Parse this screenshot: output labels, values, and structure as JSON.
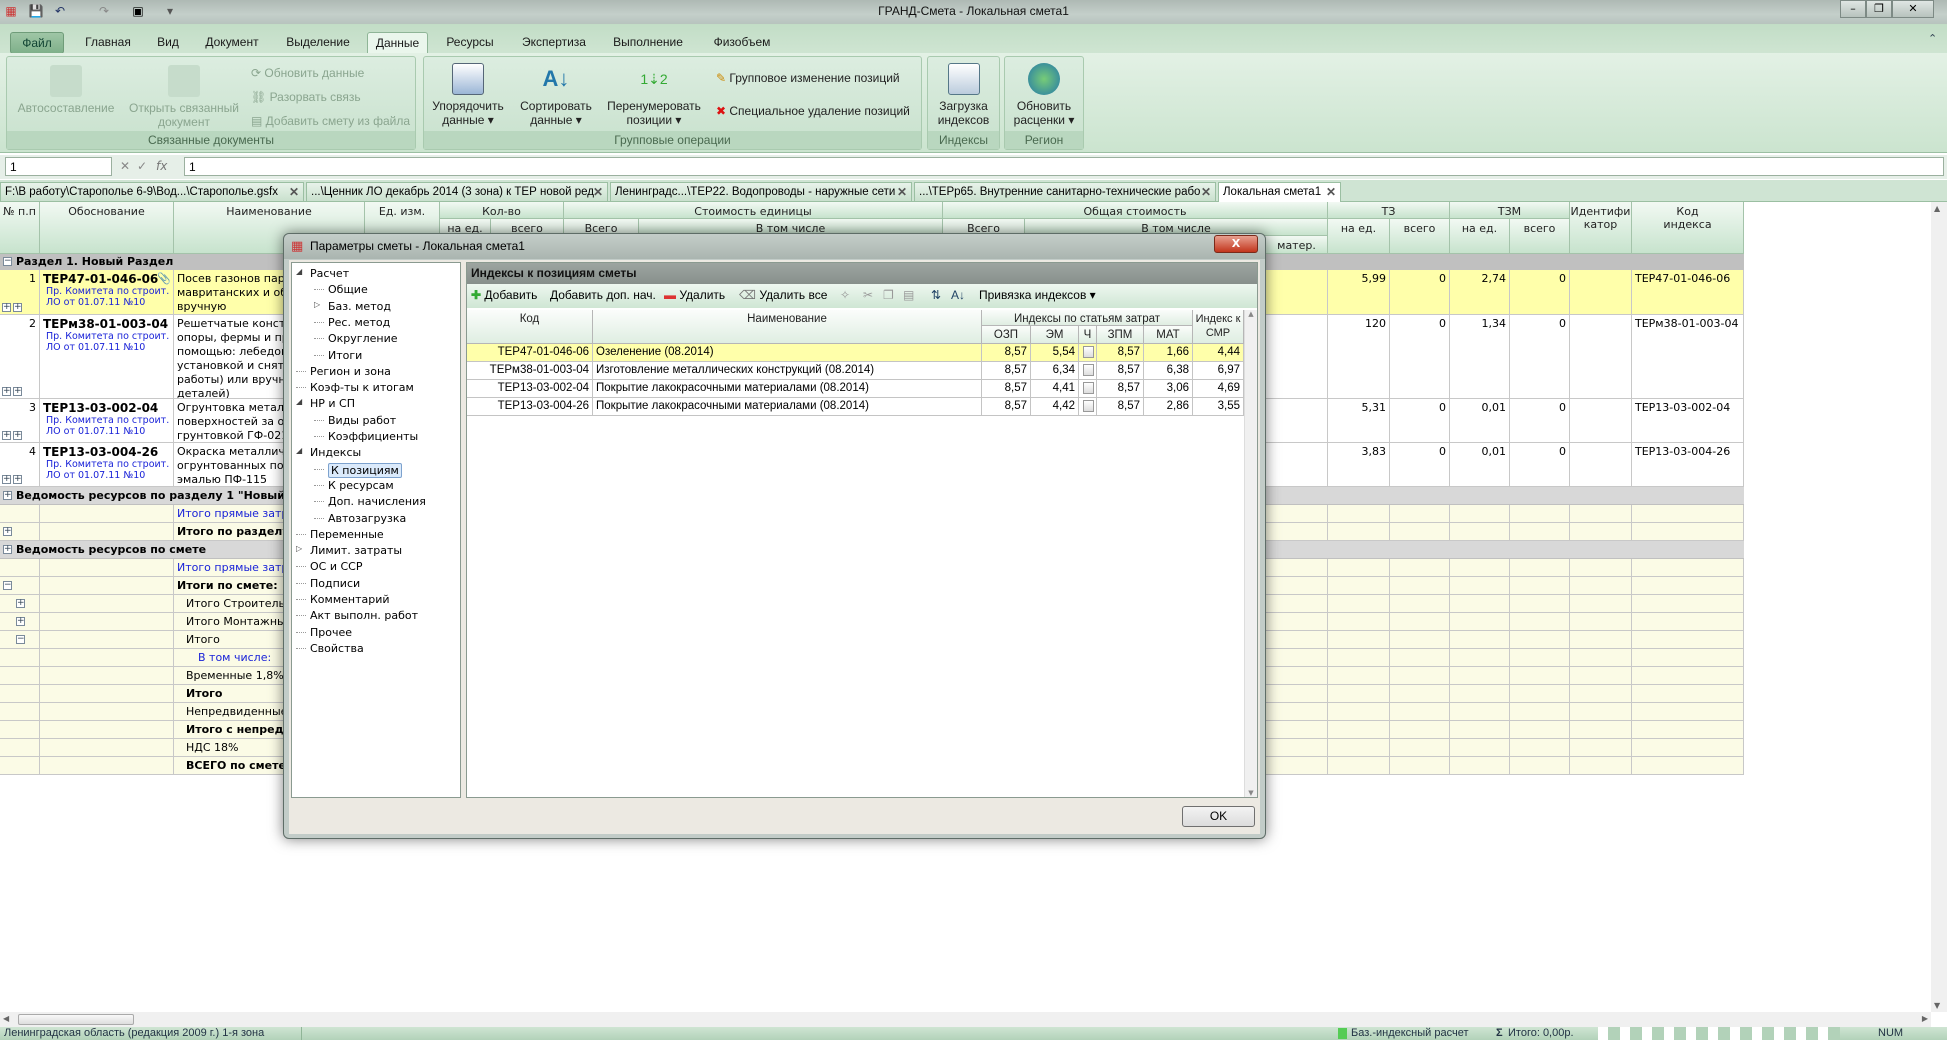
{
  "window": {
    "title": "ГРАНД-Смета - Локальная смета1"
  },
  "ribbon": {
    "tabs": [
      "Файл",
      "Главная",
      "Вид",
      "Документ",
      "Выделение",
      "Данные",
      "Ресурсы",
      "Экспертиза",
      "Выполнение",
      "Физобъем"
    ],
    "active_tab": "Данные",
    "groups": {
      "linked": {
        "label": "Связанные документы",
        "autocompose": "Автосоставление",
        "open_linked_1": "Открыть связанный",
        "open_linked_2": "документ",
        "refresh": "Обновить данные",
        "break_link": "Разорвать связь",
        "add_from_file": "Добавить смету из файла"
      },
      "group_ops": {
        "label": "Групповые операции",
        "order_1": "Упорядочить",
        "order_2": "данные ▾",
        "sort_1": "Сортировать",
        "sort_2": "данные ▾",
        "renum_1": "Перенумеровать",
        "renum_2": "позиции ▾",
        "group_change": "Групповое изменение позиций",
        "special_delete": "Специальное удаление позиций"
      },
      "indexes": {
        "label": "Индексы",
        "load_1": "Загрузка",
        "load_2": "индексов"
      },
      "region": {
        "label": "Регион",
        "update_1": "Обновить",
        "update_2": "расценки ▾"
      }
    }
  },
  "formula_bar": {
    "cell_ref": "1",
    "value": "1",
    "cancel": "✕",
    "accept": "✓",
    "fx": "fx"
  },
  "doc_tabs": [
    {
      "label": "F:\\В работу\\Старополье 6-9\\Вод...\\Старополье.gsfx"
    },
    {
      "label": "...\\Ценник ЛО декабрь 2014 (3 зона) к ТЕР новой ред"
    },
    {
      "label": "Ленинградс...\\ТЕР22. Водопроводы - наружные сети"
    },
    {
      "label": "...\\ТЕРр65. Внутренние санитарно-технические рабо"
    },
    {
      "label": "Локальная смета1",
      "active": true
    }
  ],
  "grid": {
    "headers": {
      "num": "№ п.п",
      "basis": "Обоснование",
      "name": "Наименование",
      "unit": "Ед. изм.",
      "qty": "Кол-во",
      "qty_unit": "на ед.",
      "qty_total": "всего",
      "unit_cost": "Стоимость единицы",
      "uc_total": "Всего",
      "uc_incl": "В том числе",
      "total_cost": "Общая стоимость",
      "tc_total": "Всего",
      "tc_incl": "В том числе",
      "mater": "матер.",
      "tz": "ТЗ",
      "tz_unit": "на ед.",
      "tz_total": "всего",
      "tzm": "ТЗМ",
      "tzm_unit": "на ед.",
      "tzm_total": "всего",
      "ident": "Идентифи катор",
      "index_code": "Код индекса"
    },
    "section": "Раздел 1. Новый Раздел",
    "positions": [
      {
        "num": "1",
        "code": "ТЕР47-01-046-06",
        "source": "Пр. Комитета по строит. ЛО от 01.07.11 №10",
        "name": "Посев газонов парте\nмавританских и обы\nвручную",
        "tz_unit": "5,99",
        "tz_total": "0",
        "tzm_unit": "2,74",
        "tzm_total": "0",
        "index_code": "ТЕР47-01-046-06",
        "selected": true
      },
      {
        "num": "2",
        "code": "ТЕРм38-01-003-04",
        "source": "Пр. Комитета по строит. ЛО от 01.07.11 №10",
        "name": "Решетчатые констр\nопоры, фермы и пр.\nпомощью: лебедок\nустановкой и сняти\nработы) или вручну\nдеталей)",
        "tz_unit": "120",
        "tz_total": "0",
        "tzm_unit": "1,34",
        "tzm_total": "0",
        "index_code": "ТЕРм38-01-003-04"
      },
      {
        "num": "3",
        "code": "ТЕР13-03-002-04",
        "source": "Пр. Комитета по строит. ЛО от 01.07.11 №10",
        "name": "Огрунтовка металли\nповерхностей за од\nгрунтовкой ГФ-021",
        "tz_unit": "5,31",
        "tz_total": "0",
        "tzm_unit": "0,01",
        "tzm_total": "0",
        "index_code": "ТЕР13-03-002-04"
      },
      {
        "num": "4",
        "code": "ТЕР13-03-004-26",
        "source": "Пр. Комитета по строит. ЛО от 01.07.11 №10",
        "name": "Окраска металличе\nогрунтованных пове\nэмалью ПФ-115",
        "tz_unit": "3,83",
        "tz_total": "0",
        "tzm_unit": "0,01",
        "tzm_total": "0",
        "index_code": "ТЕР13-03-004-26"
      }
    ],
    "summary_rows": [
      {
        "text": "Ведомость ресурсов по разделу 1 \"Новый Ра",
        "kind": "section",
        "toggle": "+"
      },
      {
        "text": "Итого прямые затра",
        "kind": "blue"
      },
      {
        "text": "Итого по разделу",
        "kind": "bold",
        "toggle": "+"
      },
      {
        "text": "Ведомость ресурсов по смете",
        "kind": "section",
        "toggle": "+"
      },
      {
        "text": "Итого прямые затра",
        "kind": "blue"
      },
      {
        "text": "Итоги по смете:",
        "kind": "bold",
        "toggle": "−"
      },
      {
        "text": "Итого Строительн",
        "kind": "indent",
        "toggle2": "+"
      },
      {
        "text": "Итого Монтажные",
        "kind": "indent",
        "toggle2": "+"
      },
      {
        "text": "Итого",
        "kind": "indent",
        "toggle2": "−"
      },
      {
        "text": "В том числе:",
        "kind": "blue-indent"
      },
      {
        "text": "Временные 1,8%",
        "kind": "indent"
      },
      {
        "text": "Итого",
        "kind": "bold-indent"
      },
      {
        "text": "Непредвиденные",
        "kind": "indent"
      },
      {
        "text": "Итого с непред",
        "kind": "bold-indent"
      },
      {
        "text": "НДС 18%",
        "kind": "indent"
      },
      {
        "text": "ВСЕГО по смете",
        "kind": "bold-indent"
      }
    ]
  },
  "dialog": {
    "title": "Параметры сметы - Локальная смета1",
    "close": "X",
    "tree": [
      {
        "label": "Расчет",
        "level": 0,
        "exp": "◢"
      },
      {
        "label": "Общие",
        "level": 1
      },
      {
        "label": "Баз. метод",
        "level": 1,
        "exp": "▷"
      },
      {
        "label": "Рес. метод",
        "level": 1
      },
      {
        "label": "Округление",
        "level": 1
      },
      {
        "label": "Итоги",
        "level": 1
      },
      {
        "label": "Регион и зона",
        "level": 0
      },
      {
        "label": "Коэф-ты к итогам",
        "level": 0
      },
      {
        "label": "НР и СП",
        "level": 0,
        "exp": "◢"
      },
      {
        "label": "Виды работ",
        "level": 1
      },
      {
        "label": "Коэффициенты",
        "level": 1
      },
      {
        "label": "Индексы",
        "level": 0,
        "exp": "◢"
      },
      {
        "label": "К позициям",
        "level": 1,
        "selected": true
      },
      {
        "label": "К ресурсам",
        "level": 1
      },
      {
        "label": "Доп. начисления",
        "level": 1
      },
      {
        "label": "Автозагрузка",
        "level": 1
      },
      {
        "label": "Переменные",
        "level": 0
      },
      {
        "label": "Лимит. затраты",
        "level": 0,
        "exp": "▷"
      },
      {
        "label": "ОС и ССР",
        "level": 0
      },
      {
        "label": "Подписи",
        "level": 0
      },
      {
        "label": "Комментарий",
        "level": 0
      },
      {
        "label": "Акт выполн. работ",
        "level": 0
      },
      {
        "label": "Прочее",
        "level": 0
      },
      {
        "label": "Свойства",
        "level": 0
      }
    ],
    "panel_title": "Индексы к позициям сметы",
    "toolbar": {
      "add": "Добавить",
      "add_extra": "Добавить доп. нач.",
      "delete": "Удалить",
      "delete_all": "Удалить все",
      "binding": "Привязка индексов ▾"
    },
    "table": {
      "headers": {
        "code": "Код",
        "name": "Наименование",
        "group": "Индексы по статьям затрат",
        "ozp": "ОЗП",
        "em": "ЭМ",
        "ch": "Ч",
        "zpm": "ЗПМ",
        "mat": "МАТ",
        "smr": "Индекс к СМР"
      },
      "rows": [
        {
          "code": "ТЕР47-01-046-06",
          "name": "Озеленение (08.2014)",
          "ozp": "8,57",
          "em": "5,54",
          "ch": false,
          "zpm": "8,57",
          "mat": "1,66",
          "smr": "4,44",
          "selected": true
        },
        {
          "code": "ТЕРм38-01-003-04",
          "name": "Изготовление металлических конструкций (08.2014)",
          "ozp": "8,57",
          "em": "6,34",
          "ch": false,
          "zpm": "8,57",
          "mat": "6,38",
          "smr": "6,97"
        },
        {
          "code": "ТЕР13-03-002-04",
          "name": "Покрытие лакокрасочными материалами (08.2014)",
          "ozp": "8,57",
          "em": "4,41",
          "ch": false,
          "zpm": "8,57",
          "mat": "3,06",
          "smr": "4,69"
        },
        {
          "code": "ТЕР13-03-004-26",
          "name": "Покрытие лакокрасочными материалами (08.2014)",
          "ozp": "8,57",
          "em": "4,42",
          "ch": false,
          "zpm": "8,57",
          "mat": "2,86",
          "smr": "3,55"
        }
      ]
    },
    "ok": "OK"
  },
  "status": {
    "region": "Ленинградская область (редакция 2009 г.)  1-я зона",
    "calc_method": "Баз.-индексный расчет",
    "total": "Итого: 0,00р.",
    "num": "NUM"
  },
  "colors": {
    "ribbon": "#cbe4cf",
    "selected_row": "#ffffaa",
    "section_row": "#c0c0c0",
    "summary_row": "#fbfbe6",
    "link_blue": "#1a23d8"
  }
}
